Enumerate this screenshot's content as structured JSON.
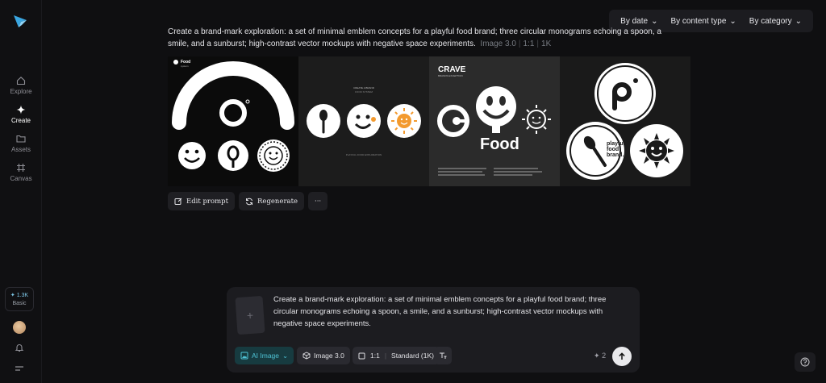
{
  "sidebar": {
    "items": [
      {
        "label": "Explore",
        "icon": "home-icon"
      },
      {
        "label": "Create",
        "icon": "sparkle-icon"
      },
      {
        "label": "Assets",
        "icon": "folder-icon"
      },
      {
        "label": "Canvas",
        "icon": "frame-icon"
      }
    ],
    "credits": "1.3K",
    "plan": "Basic"
  },
  "filters": [
    "By date",
    "By content type",
    "By category"
  ],
  "result": {
    "prompt": "Create a brand-mark exploration: a set of minimal emblem concepts for a playful food brand; three circular monograms echoing a spoon, a smile, and a sunburst; high-contrast vector mockups with negative space experiments.",
    "model": "Image 3.0",
    "ratio": "1:1",
    "resolution": "1K",
    "images": {
      "img1_brand": "Food",
      "img1_brand_sub": "system",
      "img2_header1": "CREATE A BRAND",
      "img2_header2": "FOOD SYSTEM",
      "img2_footer": "PLAYFUL FOOD EXPLORATION",
      "img3_brand": "CRAVE",
      "img3_sub": "BRANDS EXCEPTION",
      "img3_word": "Food",
      "img4_line1": "playful",
      "img4_line2": "food",
      "img4_line3": "brand."
    }
  },
  "actions": {
    "edit": "Edit prompt",
    "regenerate": "Regenerate",
    "more": "···"
  },
  "composer": {
    "prompt": "Create a brand-mark exploration: a set of minimal emblem concepts for a playful food brand; three circular monograms echoing a spoon, a smile, and a sunburst; high-contrast vector mockups with negative space experiments.",
    "ref_placeholder": "+",
    "mode": "AI Image",
    "model": "Image 3.0",
    "ratio": "1:1",
    "quality": "Standard (1K)",
    "cost": "2"
  },
  "colors": {
    "accent": "#4fc4d6",
    "orange": "#f39a2e",
    "background": "#0f0f11"
  }
}
